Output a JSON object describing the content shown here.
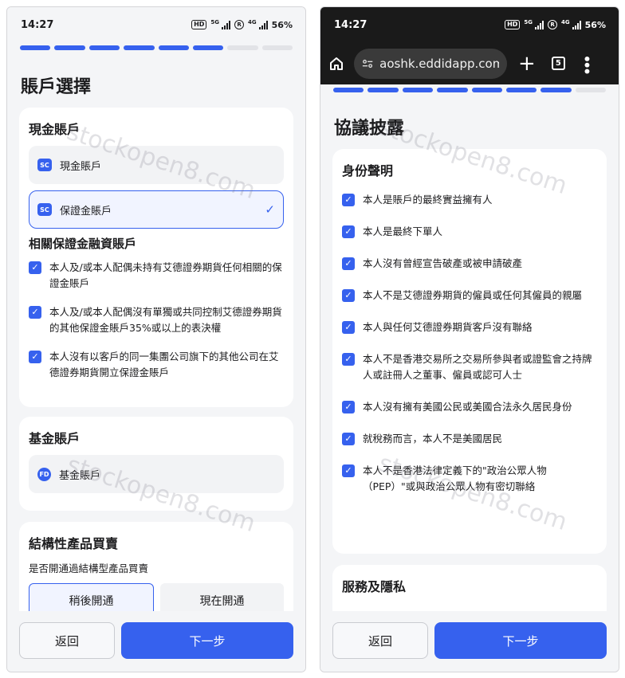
{
  "watermark": "stockopen8.com",
  "left": {
    "status": {
      "time": "14:27",
      "hd": "HD",
      "sg5": "5G",
      "sg4": "4G",
      "r": "R",
      "battery": "56%"
    },
    "progress_total": 8,
    "progress_done": 6,
    "title": "賬戶選擇",
    "cash": {
      "title": "現金賬戶",
      "options": [
        {
          "badge": "SC",
          "label": "現金賬戶",
          "selected": false
        },
        {
          "badge": "SC",
          "label": "保證金賬戶",
          "selected": true
        }
      ]
    },
    "margin_related": {
      "title": "相關保證金融資賬戶",
      "items": [
        "本人及/或本人配偶未持有艾德證券期貨任何相關的保證金賬戶",
        "本人及/或本人配偶沒有單獨或共同控制艾德證券期貨的其他保證金賬戶35%或以上的表決權",
        "本人沒有以客戶的同一集團公司旗下的其他公司在艾德證券期貨開立保證金賬戶"
      ]
    },
    "fund": {
      "title": "基金賬戶",
      "badge": "FD",
      "option": "基金賬戶"
    },
    "structured": {
      "title": "結構性產品買賣",
      "question": "是否開通過結構型產品買賣",
      "opt_later": "稍後開通",
      "opt_now": "現在開通"
    },
    "footer": {
      "back": "返回",
      "next": "下一步"
    }
  },
  "right": {
    "status": {
      "time": "14:27",
      "hd": "HD",
      "sg5": "5G",
      "sg4": "4G",
      "r": "R",
      "battery": "56%"
    },
    "browser": {
      "url": "aoshk.eddidapp.com/c",
      "tabs": "5"
    },
    "progress_total": 8,
    "progress_done": 7,
    "title": "協議披露",
    "identity": {
      "title": "身份聲明",
      "items": [
        "本人是賬戶的最終實益擁有人",
        "本人是最終下單人",
        "本人沒有曾經宣告破產或被申請破產",
        "本人不是艾德證券期貨的僱員或任何其僱員的親屬",
        "本人與任何艾德證券期貨客戶沒有聯絡",
        "本人不是香港交易所之交易所參與者或證監會之持牌人或註冊人之董事、僱員或認可人士",
        "本人沒有擁有美國公民或美國合法永久居民身份",
        "就稅務而言，本人不是美國居民",
        "本人不是香港法律定義下的\"政治公眾人物（PEP）\"或與政治公眾人物有密切聯絡"
      ]
    },
    "services": {
      "title": "服務及隱私"
    },
    "footer": {
      "back": "返回",
      "next": "下一步"
    }
  },
  "colors": {
    "accent": "#3661ee",
    "page_bg": "#f4f5f7",
    "card_bg": "#ffffff"
  }
}
